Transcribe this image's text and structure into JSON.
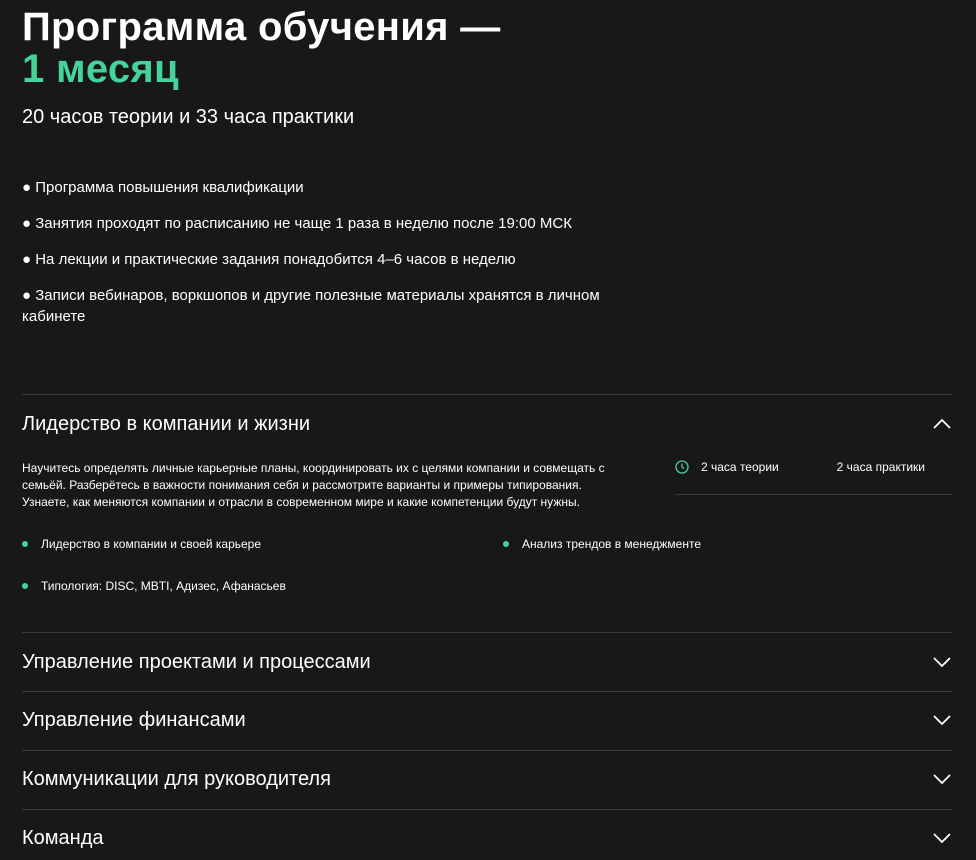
{
  "header": {
    "title": "Программа обучения —",
    "title_accent": "1 месяц",
    "subtitle": "20 часов теории и 33 часа практики"
  },
  "bullets": [
    "● Программа повышения квалификации",
    "● Занятия проходят по расписанию не чаще 1 раза в неделю после 19:00 МСК",
    "● На лекции и практические задания понадобится 4–6 часов в неделю",
    "● Записи вебинаров, воркшопов и другие полезные материалы хранятся в личном кабинете"
  ],
  "modules": [
    {
      "title": "Лидерство в компании и жизни",
      "expanded": true,
      "description": "Научитесь определять личные карьерные планы, координировать их с целями компании и совмещать с семьёй. Разберётесь в важности понимания себя и рассмотрите варианты и примеры типирования. Узнаете, как меняются компании и отрасли в современном мире и какие компетенции будут нужны.",
      "theory": "2 часа теории",
      "practice": "2 часа практики",
      "topics": [
        "Лидерство в компании и своей карьере",
        "Анализ трендов в менеджменте",
        "Типология: DISC, MBTI, Адизес, Афанасьев"
      ]
    },
    {
      "title": "Управление проектами и процессами",
      "expanded": false
    },
    {
      "title": "Управление финансами",
      "expanded": false
    },
    {
      "title": "Коммуникации для руководителя",
      "expanded": false
    },
    {
      "title": "Команда",
      "expanded": false
    }
  ],
  "colors": {
    "accent": "#46d39b",
    "background": "#181818"
  }
}
